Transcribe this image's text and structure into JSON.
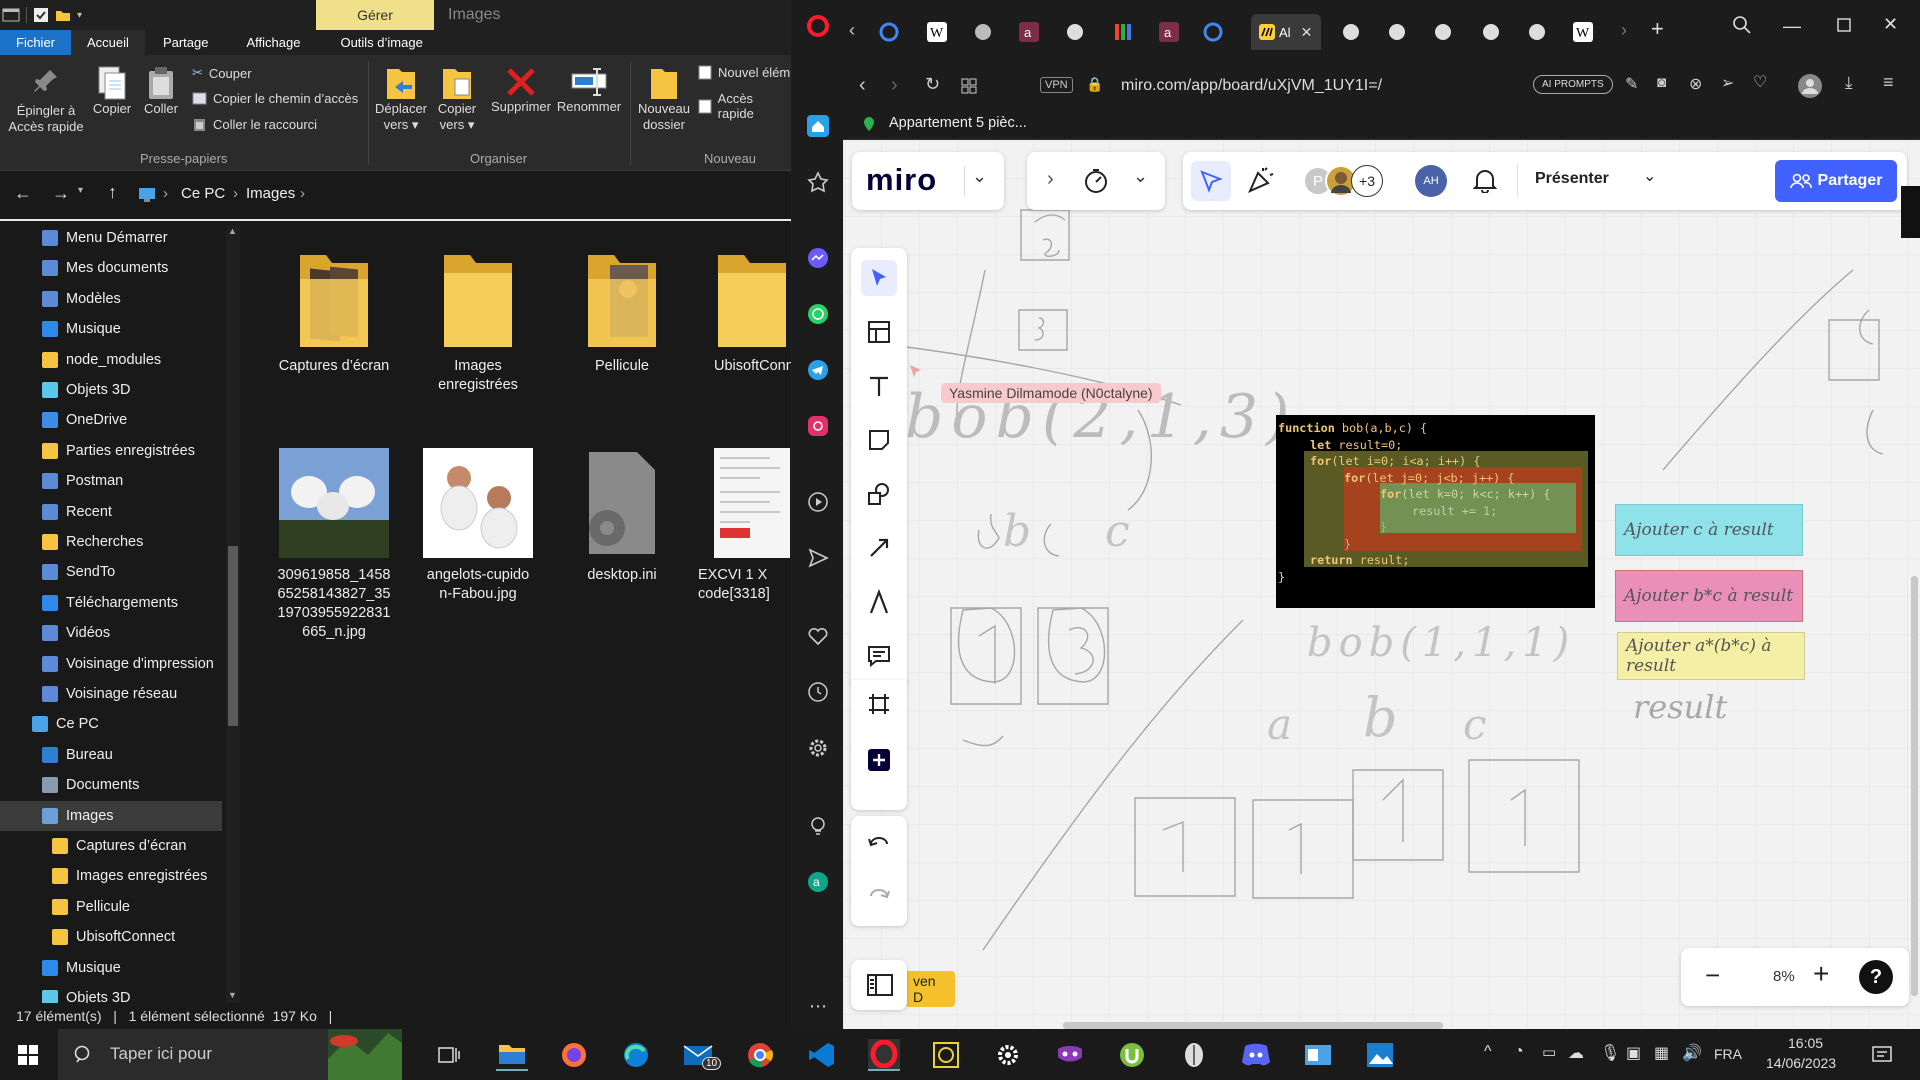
{
  "explorer": {
    "title": "Images",
    "context_tab": "Gérer",
    "ribbon_tabs": [
      "Fichier",
      "Accueil",
      "Partage",
      "Affichage",
      "Outils d’image"
    ],
    "ribbon": {
      "pin_line1": "Épingler à",
      "pin_line2": "Accès rapide",
      "copy": "Copier",
      "paste": "Coller",
      "cut": "Couper",
      "copy_path": "Copier le chemin d’accès",
      "paste_shortcut": "Coller le raccourci",
      "move_line1": "Déplacer",
      "move_line2": "vers",
      "copyto_line1": "Copier",
      "copyto_line2": "vers",
      "delete": "Supprimer",
      "rename": "Renommer",
      "new_folder_line1": "Nouveau",
      "new_folder_line2": "dossier",
      "new_item": "Nouvel élém",
      "quick_access": "Accès rapide",
      "group_clipboard": "Presse-papiers",
      "group_organize": "Organiser",
      "group_new": "Nouveau"
    },
    "breadcrumb": [
      "Ce PC",
      "Images"
    ],
    "nav_items": [
      "Menu Démarrer",
      "Mes documents",
      "Modèles",
      "Musique",
      "node_modules",
      "Objets 3D",
      "OneDrive",
      "Parties enregistrées",
      "Postman",
      "Recent",
      "Recherches",
      "SendTo",
      "Téléchargements",
      "Vidéos",
      "Voisinage d'impression",
      "Voisinage réseau",
      "Ce PC",
      "Bureau",
      "Documents",
      "Images",
      "Captures d’écran",
      "Images enregistrées",
      "Pellicule",
      "UbisoftConnect",
      "Musique",
      "Objets 3D"
    ],
    "files": [
      {
        "line1": "Captures d’écran",
        "line2": "",
        "line3": "",
        "line4": ""
      },
      {
        "line1": "Images",
        "line2": "enregistrées",
        "line3": "",
        "line4": ""
      },
      {
        "line1": "Pellicule",
        "line2": "",
        "line3": "",
        "line4": ""
      },
      {
        "line1": "UbisoftConn",
        "line2": "",
        "line3": "",
        "line4": ""
      },
      {
        "line1": "309619858_1458",
        "line2": "65258143827_35",
        "line3": "19703955922831",
        "line4": "665_n.jpg"
      },
      {
        "line1": "angelots-cupido",
        "line2": "n-Fabou.jpg",
        "line3": "",
        "line4": ""
      },
      {
        "line1": "desktop.ini",
        "line2": "",
        "line3": "",
        "line4": ""
      },
      {
        "line1": "EXCVI 1 X",
        "line2": "code[3318]",
        "line3": "",
        "line4": ""
      }
    ],
    "status": "17 élément(s)   |   1 élément sélectionné  197 Ko   |"
  },
  "browser": {
    "active_tab": "Al",
    "url": "miro.com/app/board/uXjVM_1UY1I=/",
    "vpn": "VPN",
    "ai_prompts": "AI PROMPTS",
    "bookmark": "Appartement 5 pièc..."
  },
  "miro": {
    "logo": "miro",
    "avatar_p": "P",
    "more_users": "+3",
    "avatar_ah": "AH",
    "present": "Présenter",
    "share": "Partager",
    "zoom": "8%",
    "help": "?",
    "collab_label": "Yasmine Dilmamode (N0ctalyne)",
    "collab2": "ven D",
    "code_lines": [
      {
        "kw": "function",
        "rest": " bob(a,b,c) {"
      },
      {
        "kw": "let",
        "rest": " result=0;"
      },
      {
        "kw": "for",
        "rest": "(let i=0; i<a; i++) {"
      },
      {
        "kw": "for",
        "rest": "(let j=0; j<b; j++) {"
      },
      {
        "kw": "for",
        "rest": "(let k=0; k<c; k++) {"
      },
      {
        "kw": "",
        "rest": "result += 1;"
      },
      {
        "kw": "return",
        "rest": " result;"
      }
    ],
    "stickies": [
      "Ajouter c à result",
      "Ajouter b*c à result",
      "Ajouter a*(b*c) à result"
    ],
    "handwriting": {
      "bob_call1": "bob(2,1,3)",
      "bob_call2": "bob(1,1,1)",
      "result": "result",
      "a": "a",
      "b": "b",
      "c": "c"
    }
  },
  "taskbar": {
    "search": "Taper ici pour",
    "mail_badge": "10",
    "lang": "FRA",
    "time": "16:05",
    "date": "14/06/2023"
  }
}
